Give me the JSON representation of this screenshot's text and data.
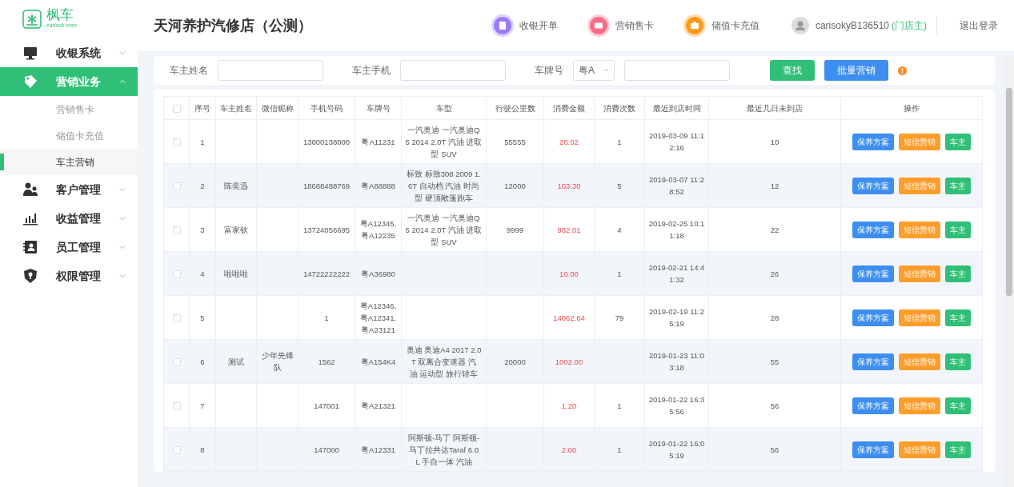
{
  "logo": {
    "name": "枫车",
    "domain": "carisok·com"
  },
  "sidebar": {
    "items": [
      {
        "label": "收银系统",
        "expanded": false,
        "selected": false
      },
      {
        "label": "营销业务",
        "expanded": true,
        "selected": true,
        "children": [
          {
            "label": "营销售卡",
            "selected": false
          },
          {
            "label": "储值卡充值",
            "selected": false
          },
          {
            "label": "车主营销",
            "selected": true
          }
        ]
      },
      {
        "label": "客户管理",
        "expanded": false,
        "selected": false
      },
      {
        "label": "收益管理",
        "expanded": false,
        "selected": false
      },
      {
        "label": "员工管理",
        "expanded": false,
        "selected": false
      },
      {
        "label": "权限管理",
        "expanded": false,
        "selected": false
      }
    ]
  },
  "header": {
    "title": "天河养护汽修店（公测）",
    "shortcuts": [
      {
        "label": "收银开单",
        "color": "#9b7cf5"
      },
      {
        "label": "营销售卡",
        "color": "#fb6d87"
      },
      {
        "label": "储值卡充值",
        "color": "#ff9a1f"
      }
    ],
    "user": "carisokyB136510",
    "role": "(门店主)",
    "logout": "退出登录"
  },
  "filters": {
    "fields": [
      {
        "label": "车主姓名"
      },
      {
        "label": "车主手机"
      }
    ],
    "plate": {
      "label": "车牌号",
      "prefix": "粤A"
    },
    "search_button": "查找",
    "batch_button": "批量营销"
  },
  "table": {
    "all_checked": false,
    "columns": [
      "序号",
      "车主姓名",
      "微信昵称",
      "手机号码",
      "车牌号",
      "车型",
      "行驶公里数",
      "消费金额",
      "消费次数",
      "最近到店时间",
      "最近几日未到店",
      "操作"
    ],
    "rows": [
      {
        "checked": false,
        "cells": [
          "1",
          "",
          "",
          "13800138000",
          "粤A11231",
          "一汽奥迪 一汽奥迪Q5 2014 2.0T 汽油 进取型 SUV",
          "55555",
          "26.02",
          "1",
          "2019-03-09 11:12:16",
          "10"
        ],
        "actions": [
          {
            "label": "保养方案",
            "kind": "plan"
          },
          {
            "label": "短信营销",
            "kind": "sms"
          },
          {
            "label": "车主",
            "kind": "owner"
          }
        ]
      },
      {
        "checked": false,
        "cells": [
          "2",
          "陈奕迅",
          "",
          "18688488769",
          "粤A88888",
          "标致 标致308 2009 1.6T 自动档 汽油 时尚型 硬顶敞篷跑车",
          "12000",
          "103.30",
          "5",
          "2019-03-07 11:28:52",
          "12"
        ],
        "actions": [
          {
            "label": "保养方案",
            "kind": "plan"
          },
          {
            "label": "短信营销",
            "kind": "sms"
          },
          {
            "label": "车主",
            "kind": "owner"
          }
        ]
      },
      {
        "checked": false,
        "cells": [
          "3",
          "富家钦",
          "",
          "13724056695",
          "粤A12345,粤A12235",
          "一汽奥迪 一汽奥迪Q5 2014 2.0T 汽油 进取型 SUV",
          "9999",
          "932.01",
          "4",
          "2019-02-25 10:11:18",
          "22"
        ],
        "actions": [
          {
            "label": "保养方案",
            "kind": "plan"
          },
          {
            "label": "短信营销",
            "kind": "sms"
          },
          {
            "label": "车主",
            "kind": "owner"
          }
        ]
      },
      {
        "checked": false,
        "cells": [
          "4",
          "啦啦啦",
          "",
          "14722222222",
          "粤A36980",
          "",
          "",
          "10.00",
          "1",
          "2019-02-21 14:41:32",
          "26"
        ],
        "actions": [
          {
            "label": "保养方案",
            "kind": "plan"
          },
          {
            "label": "短信营销",
            "kind": "sms"
          },
          {
            "label": "车主",
            "kind": "owner"
          }
        ]
      },
      {
        "checked": false,
        "cells": [
          "5",
          "",
          "",
          "1",
          "粤A12346,粤A12341,粤A23121",
          "",
          "",
          "14062.64",
          "79",
          "2019-02-19 11:25:19",
          "28"
        ],
        "actions": [
          {
            "label": "保养方案",
            "kind": "plan"
          },
          {
            "label": "短信营销",
            "kind": "sms"
          },
          {
            "label": "车主",
            "kind": "owner"
          }
        ]
      },
      {
        "checked": false,
        "cells": [
          "6",
          "测试",
          "少年先锋队",
          "1562",
          "粤A154K4",
          "奥迪 奥迪A4 2017 2.0T 双离合变速器 汽油 运动型 旅行轿车",
          "20000",
          "1002.00",
          "",
          "2019-01-23 11:03:18",
          "55"
        ],
        "actions": [
          {
            "label": "保养方案",
            "kind": "plan"
          },
          {
            "label": "短信营销",
            "kind": "sms"
          },
          {
            "label": "车主",
            "kind": "owner"
          }
        ]
      },
      {
        "checked": false,
        "cells": [
          "7",
          "",
          "",
          "147001",
          "粤A21321",
          "",
          "",
          "1.20",
          "1",
          "2019-01-22 16:35:56",
          "56"
        ],
        "actions": [
          {
            "label": "保养方案",
            "kind": "plan"
          },
          {
            "label": "短信营销",
            "kind": "sms"
          },
          {
            "label": "车主",
            "kind": "owner"
          }
        ]
      },
      {
        "checked": false,
        "cells": [
          "8",
          "",
          "",
          "147000",
          "粤A12331",
          "阿斯顿-马丁 阿斯顿-马丁拉共达Taraf 6.0L 手自一体 汽油",
          "",
          "2.00",
          "1",
          "2019-01-22 16:05:19",
          "56"
        ],
        "actions": [
          {
            "label": "保养方案",
            "kind": "plan"
          },
          {
            "label": "短信营销",
            "kind": "sms"
          },
          {
            "label": "车主",
            "kind": "owner"
          }
        ]
      }
    ]
  }
}
